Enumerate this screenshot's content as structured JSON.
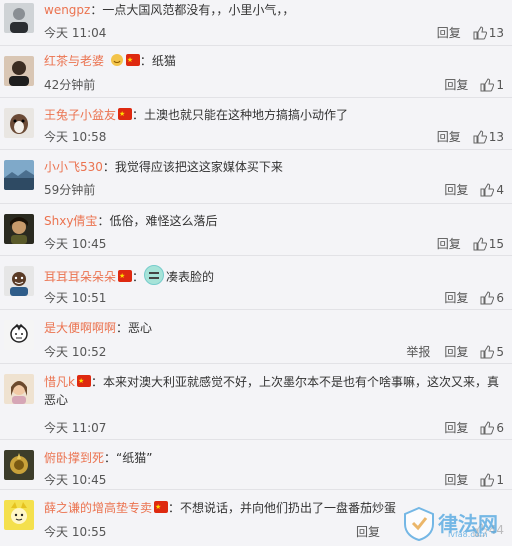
{
  "actions": {
    "reply": "回复",
    "report": "举报"
  },
  "comments": [
    {
      "user": "wengpz",
      "text": "一点大国风范都没有，，小里小气，，",
      "time": "今天 11:04",
      "likes": "13"
    },
    {
      "user": "红茶与老婆",
      "text": "纸猫",
      "time": "42分钟前",
      "likes": "1"
    },
    {
      "user": "王兔子小盆友",
      "text": "土澳也就只能在这种地方搞搞小动作了",
      "time": "今天 10:58",
      "likes": "13"
    },
    {
      "user": "小小飞530",
      "text": "我觉得应该把这这家媒体买下来",
      "time": "59分钟前",
      "likes": "4"
    },
    {
      "user": "Shxy倩宝",
      "text": "低俗，难怪这么落后",
      "time": "今天 10:45",
      "likes": "15"
    },
    {
      "user": "耳耳耳朵朵朵",
      "text": "凑表脸的",
      "time": "今天 10:51",
      "likes": "6"
    },
    {
      "user": "是大便啊啊啊",
      "text": "恶心",
      "time": "今天 10:52",
      "likes": "5"
    },
    {
      "user": "惜凡k",
      "text": "本来对澳大利亚就感觉不好，上次墨尔本不是也有个啥事嘛，这次又来，真恶心",
      "time": "今天 11:07",
      "likes": "6"
    },
    {
      "user": "俯卧撑到死",
      "text": "“纸猫”",
      "time": "今天 10:45",
      "likes": "1"
    },
    {
      "user": "薛之谦的增高垫专卖",
      "text": "不想说话，并向他们扔出了一盘番茄炒蛋",
      "time": "今天 10:55",
      "likes": "44"
    }
  ],
  "watermark": {
    "name": "律法网",
    "domain": "lvfa8.com"
  }
}
